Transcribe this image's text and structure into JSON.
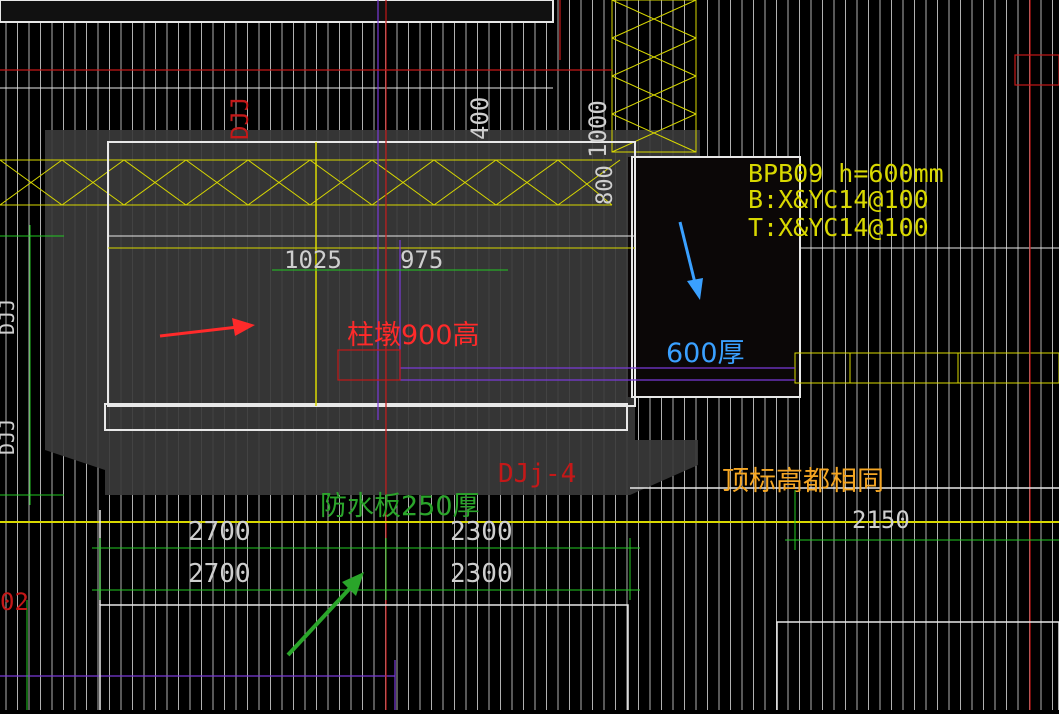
{
  "drawing": {
    "slab_label": {
      "line1": "BPB09 h=600mm",
      "line2": "B:X&YC14@100",
      "line3": "T:X&YC14@100"
    },
    "dimensions": {
      "top_left": "1025",
      "top_right": "975",
      "vertical_400": "400",
      "vertical_1000": "1000",
      "vertical_800": "800",
      "left_vertical": "DJJ",
      "left_vertical2": "DJJ",
      "red_vertical": "DJJ",
      "bottom_row1_left": "2700",
      "bottom_row1_right": "2300",
      "bottom_row2_left": "2700",
      "bottom_row2_right": "2300",
      "right_dim": "2150",
      "left_edge_red": "02"
    },
    "element_labels": {
      "djj4": "DJj-4"
    }
  },
  "annotations": {
    "column_pier": "柱墩900高",
    "thickness": "600厚",
    "top_elevation": "顶标高都相同",
    "waterproof_slab": "防水板250厚"
  },
  "colors": {
    "red_annotation": "#ff2a2a",
    "blue_annotation": "#3aa0ff",
    "orange_annotation": "#f5a623",
    "green_annotation": "#2aa52a",
    "cad_yellow": "#d8d800",
    "cad_green": "#22c822",
    "cad_white": "#e8e8e8",
    "cad_red": "#c41818",
    "cad_purple": "#7a3ad8"
  }
}
